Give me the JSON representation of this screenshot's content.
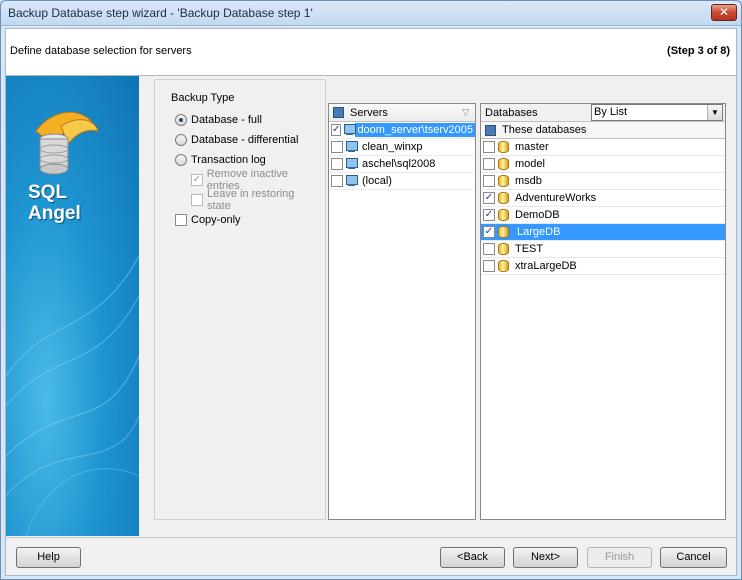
{
  "window": {
    "title": "Backup Database step wizard - 'Backup Database step 1'",
    "close_glyph": "✕"
  },
  "header": {
    "description": "Define database selection for servers",
    "step": "(Step 3 of 8)"
  },
  "banner": {
    "logo_line1": "SQL",
    "logo_line2": "Angel"
  },
  "backup_type": {
    "title": "Backup Type",
    "database_full": "Database - full",
    "database_differential": "Database - differential",
    "transaction_log": "Transaction log",
    "remove_inactive": "Remove inactive entries",
    "leave_restoring": "Leave in restoring state",
    "copy_only": "Copy-only",
    "selected": "Database - full"
  },
  "servers": {
    "header": "Servers",
    "items": [
      {
        "name": "doom_server\\tserv2005",
        "checked": true
      },
      {
        "name": "clean_winxp",
        "checked": false
      },
      {
        "name": "aschel\\sql2008",
        "checked": false
      },
      {
        "name": "(local)",
        "checked": false
      }
    ]
  },
  "databases": {
    "label": "Databases",
    "mode": "By List",
    "subheader": "These databases",
    "items": [
      {
        "name": "master",
        "checked": false
      },
      {
        "name": "model",
        "checked": false
      },
      {
        "name": "msdb",
        "checked": false
      },
      {
        "name": "AdventureWorks",
        "checked": true
      },
      {
        "name": "DemoDB",
        "checked": true
      },
      {
        "name": "LargeDB",
        "checked": true
      },
      {
        "name": "TEST",
        "checked": false
      },
      {
        "name": "xtraLargeDB",
        "checked": false
      }
    ]
  },
  "buttons": {
    "help": "Help",
    "back": "<Back",
    "next": "Next>",
    "finish": "Finish",
    "cancel": "Cancel"
  },
  "check_glyph": "✓",
  "colors": {
    "selection": "#3399ff",
    "banner": "#1e94d0"
  }
}
